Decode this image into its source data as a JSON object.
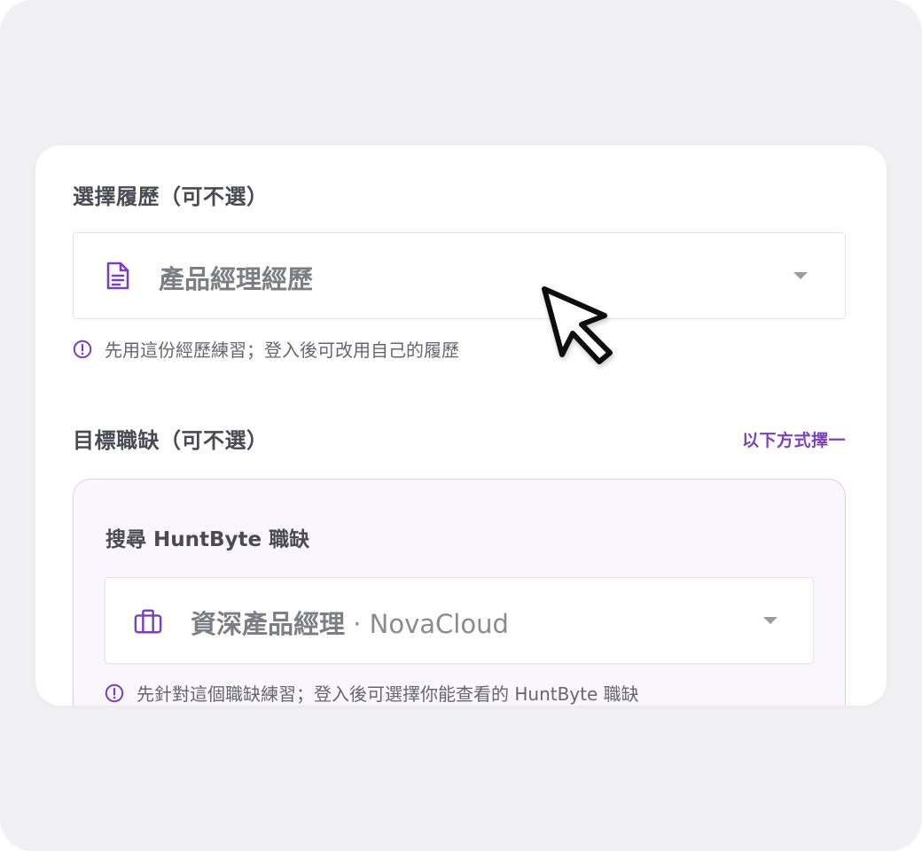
{
  "resume_section": {
    "label": "選擇履歷（可不選）",
    "select": {
      "icon": "document-icon",
      "value": "產品經理經歷"
    },
    "hint": "先用這份經歷練習；登入後可改用自己的履歷"
  },
  "job_section": {
    "label": "目標職缺（可不選）",
    "choose_one_link": "以下方式擇一",
    "panel": {
      "title": "搜尋 HuntByte 職缺",
      "select": {
        "icon": "briefcase-icon",
        "value": "資深產品經理",
        "company": " · NovaCloud"
      },
      "hint": "先針對這個職缺練習；登入後可選擇你能查看的 HuntByte 職缺"
    }
  },
  "colors": {
    "accent": "#7b3fbf",
    "frame_bg": "#f1f1f3",
    "panel_bg": "#f9f6fd"
  }
}
